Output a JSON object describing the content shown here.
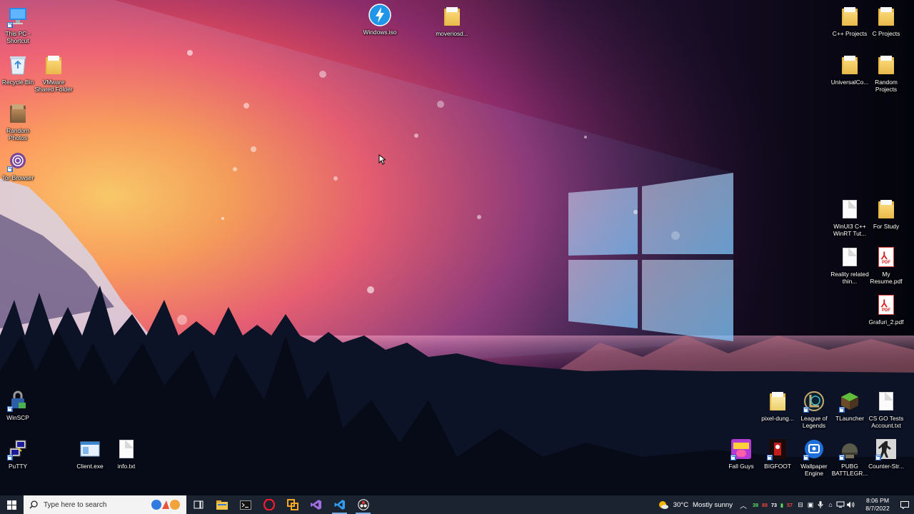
{
  "desktop": {
    "icons": {
      "this_pc": "This PC - Shortcut",
      "recycle_bin": "Recycle Bin",
      "vmware": "VMware Shared Folder",
      "random_photos": "Random Photos",
      "tor": "Tor Browser",
      "windows_iso": "Windows.iso",
      "moveriosd": "moveriosd...",
      "cpp_projects": "C++ Projects",
      "c_projects": "C Projects",
      "universalco": "UniversalCo...",
      "random_projects": "Random Projects",
      "winui3": "WinUI3 C++ WinRT Tut...",
      "for_study": "For Study",
      "reality": "Reality related thin...",
      "my_resume": "My Resume.pdf",
      "grafuri": "Grafuri_2.pdf",
      "winscp": "WinSCP",
      "putty": "PuTTY",
      "client_exe": "Client.exe",
      "info_txt": "info.txt",
      "pixel_dung": "pixel-dung...",
      "lol": "League of Legends",
      "tlauncher": "TLauncher",
      "csgo_txt": "CS GO Tests Account.txt",
      "fall_guys": "Fall Guys",
      "bigfoot": "BIGFOOT",
      "wallpaper_engine": "Wallpaper Engine",
      "pubg": "PUBG BATTLEGR...",
      "counter_strike": "Counter-Str..."
    }
  },
  "taskbar": {
    "search_placeholder": "Type here to search",
    "pinned": [
      "start-menu",
      "search",
      "task-view",
      "file-explorer",
      "terminal",
      "opera",
      "vmware",
      "visual-studio",
      "vs-code",
      "obs"
    ]
  },
  "tray": {
    "weather_temp": "30°C",
    "weather_desc": "Mostly sunny",
    "monitor_values": [
      "39",
      "88",
      "73",
      "57"
    ],
    "time": "8:06 PM",
    "date": "8/7/2022"
  },
  "colors": {
    "taskbar_bg": "#1c2330",
    "folder": "#e7b743",
    "search_bg": "#f3f3f3"
  }
}
